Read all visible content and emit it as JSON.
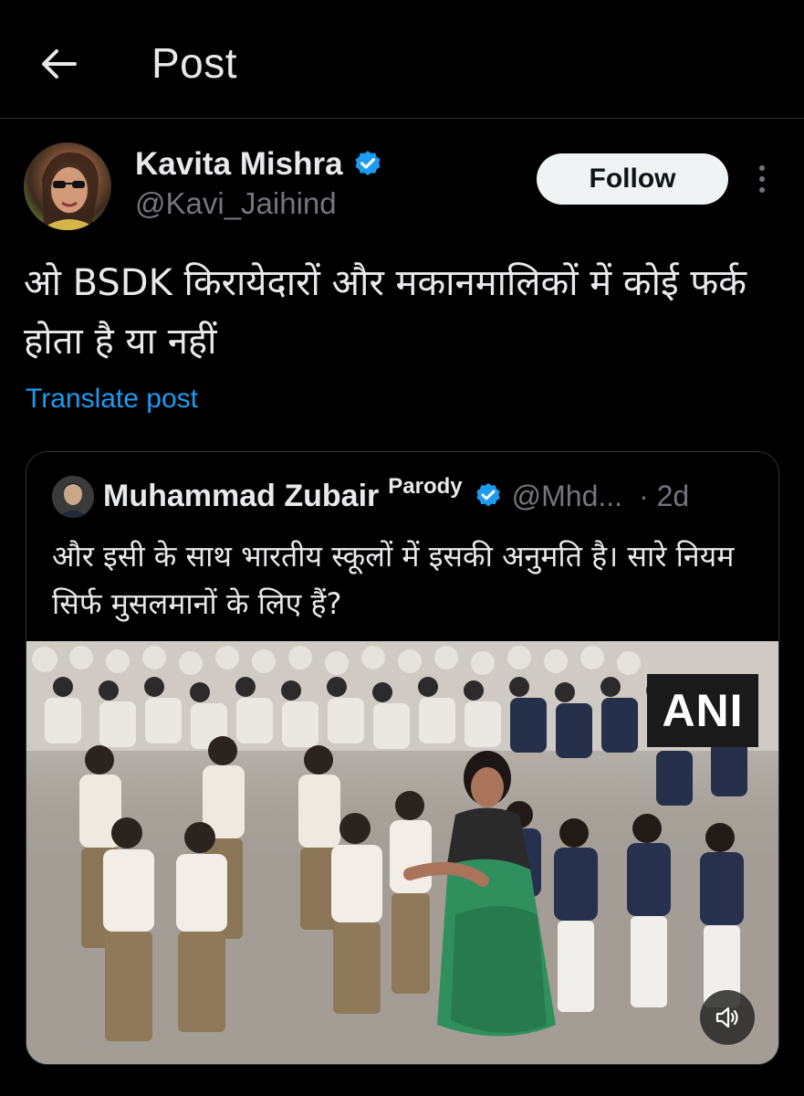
{
  "header": {
    "title": "Post",
    "back_icon": "arrow-left-icon"
  },
  "post": {
    "author": {
      "name": "Kavita Mishra",
      "handle": "@Kavi_Jaihind",
      "verified": true
    },
    "follow_label": "Follow",
    "text": "ओ BSDK किरायेदारों और मकानमालिकों में कोई फर्क होता है या नहीं",
    "translate_label": "Translate post"
  },
  "quote": {
    "author": {
      "name": "Muhammad Zubair",
      "label": "Parody",
      "handle": "@Mhd...",
      "verified": true
    },
    "time": "· 2d",
    "text": "और इसी के साथ भारतीय स्कूलों में इसकी अनुमति है। सारे नियम सिर्फ मुसलमानों के लिए हैं?",
    "video": {
      "watermark": "ANI",
      "mute_icon": "speaker-muted-icon"
    }
  },
  "colors": {
    "background": "#000000",
    "text": "#e7e9ea",
    "muted": "#71767b",
    "link": "#1d9bf0",
    "verified": "#1d9bf0",
    "border": "#2f3336"
  }
}
